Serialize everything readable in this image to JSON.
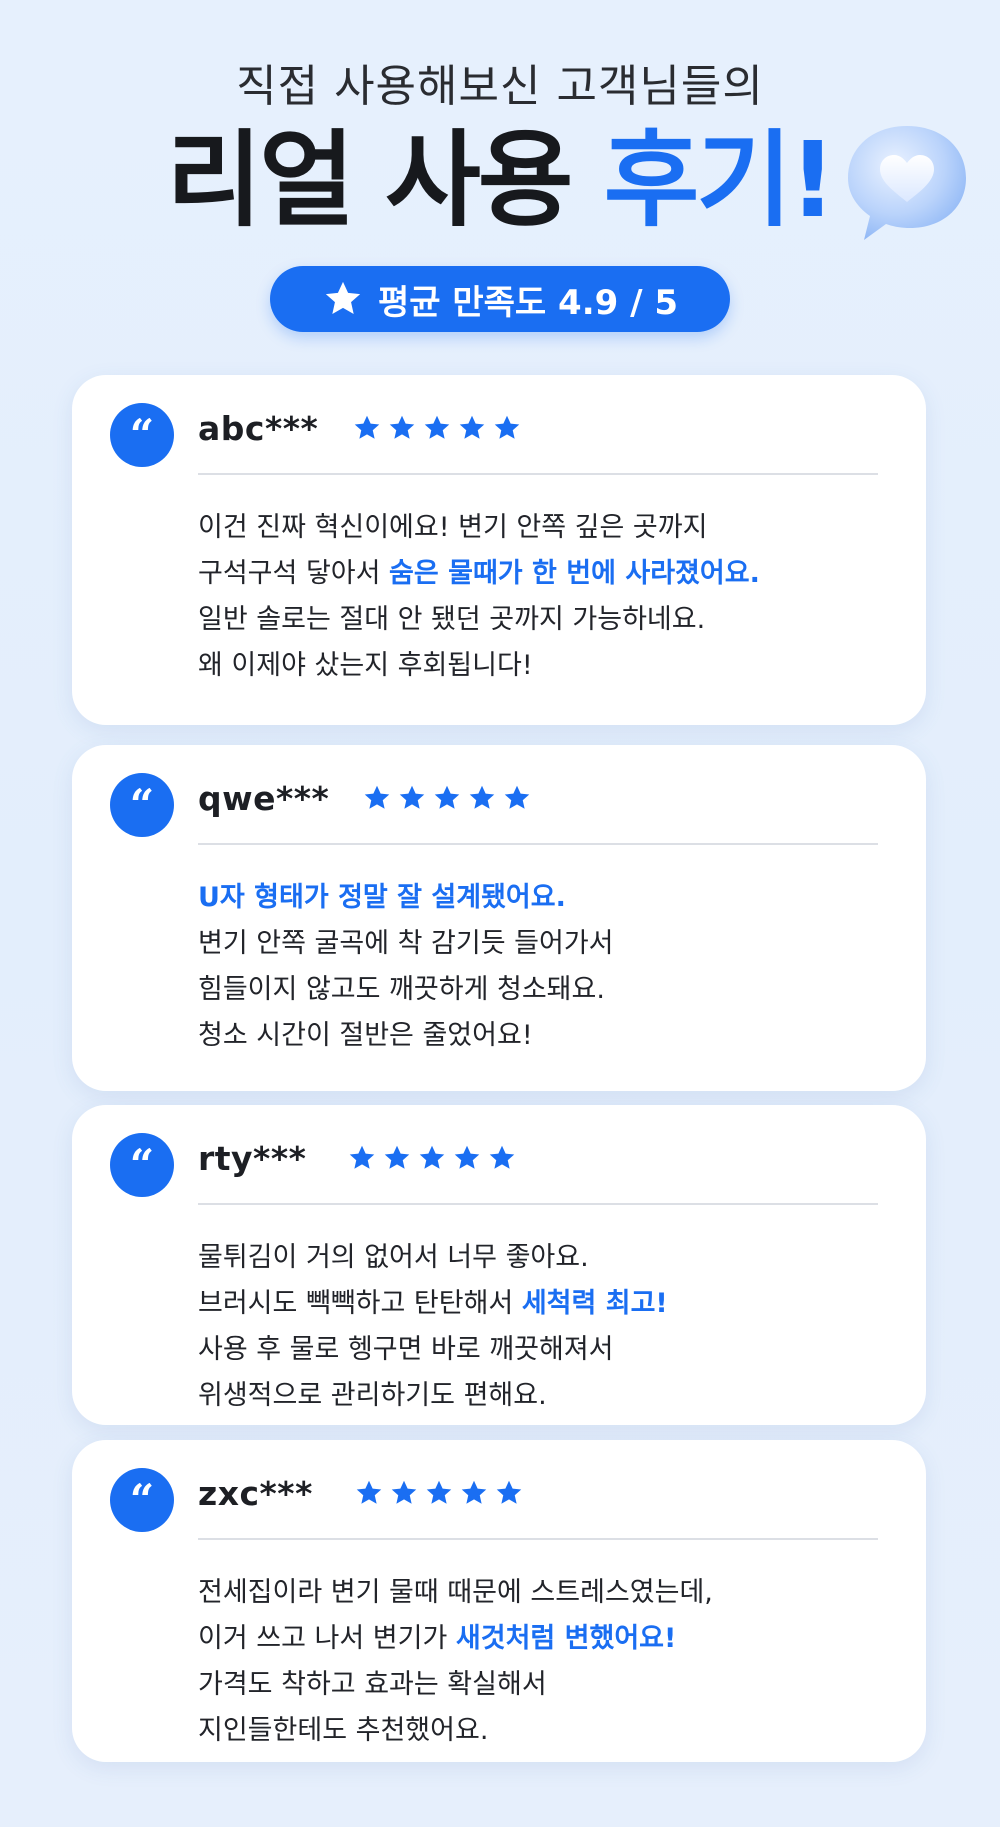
{
  "header": {
    "subtitle": "직접 사용해보신 고객님들의",
    "title_main": "리얼 사용 ",
    "title_accent": "후기!",
    "rating_label": "평균 만족도 4.9 / 5"
  },
  "colors": {
    "accent": "#1a6ef2",
    "text": "#1b1d22",
    "background": "#e5effc"
  },
  "reviews": [
    {
      "user": "abc***",
      "stars": 5,
      "lines": [
        {
          "pre": "이건 진짜 혁신이에요! 변기 안쪽 깊은 곳까지",
          "hl": "",
          "post": ""
        },
        {
          "pre": "구석구석 닿아서 ",
          "hl": "숨은 물때가 한 번에 사라졌어요.",
          "post": ""
        },
        {
          "pre": "일반 솔로는 절대 안 됐던 곳까지 가능하네요.",
          "hl": "",
          "post": ""
        },
        {
          "pre": "왜 이제야 샀는지 후회됩니다!",
          "hl": "",
          "post": ""
        }
      ]
    },
    {
      "user": "qwe***",
      "stars": 5,
      "lines": [
        {
          "pre": "",
          "hl": "U자 형태가 정말 잘 설계됐어요.",
          "post": ""
        },
        {
          "pre": "변기 안쪽 굴곡에 착 감기듯 들어가서",
          "hl": "",
          "post": ""
        },
        {
          "pre": "힘들이지 않고도 깨끗하게 청소돼요.",
          "hl": "",
          "post": ""
        },
        {
          "pre": "청소 시간이 절반은 줄었어요!",
          "hl": "",
          "post": ""
        }
      ]
    },
    {
      "user": "rty***",
      "stars": 5,
      "lines": [
        {
          "pre": "물튀김이 거의 없어서 너무 좋아요.",
          "hl": "",
          "post": ""
        },
        {
          "pre": "브러시도 빽빽하고 탄탄해서 ",
          "hl": "세척력 최고!",
          "post": ""
        },
        {
          "pre": "사용 후 물로 헹구면 바로 깨끗해져서",
          "hl": "",
          "post": ""
        },
        {
          "pre": "위생적으로 관리하기도 편해요.",
          "hl": "",
          "post": ""
        }
      ]
    },
    {
      "user": "zxc***",
      "stars": 5,
      "lines": [
        {
          "pre": "전세집이라 변기 물때 때문에 스트레스였는데,",
          "hl": "",
          "post": ""
        },
        {
          "pre": "이거 쓰고 나서 변기가 ",
          "hl": "새것처럼 변했어요!",
          "post": ""
        },
        {
          "pre": "가격도 착하고 효과는 확실해서",
          "hl": "",
          "post": ""
        },
        {
          "pre": "지인들한테도 추천했어요.",
          "hl": "",
          "post": ""
        }
      ]
    }
  ]
}
